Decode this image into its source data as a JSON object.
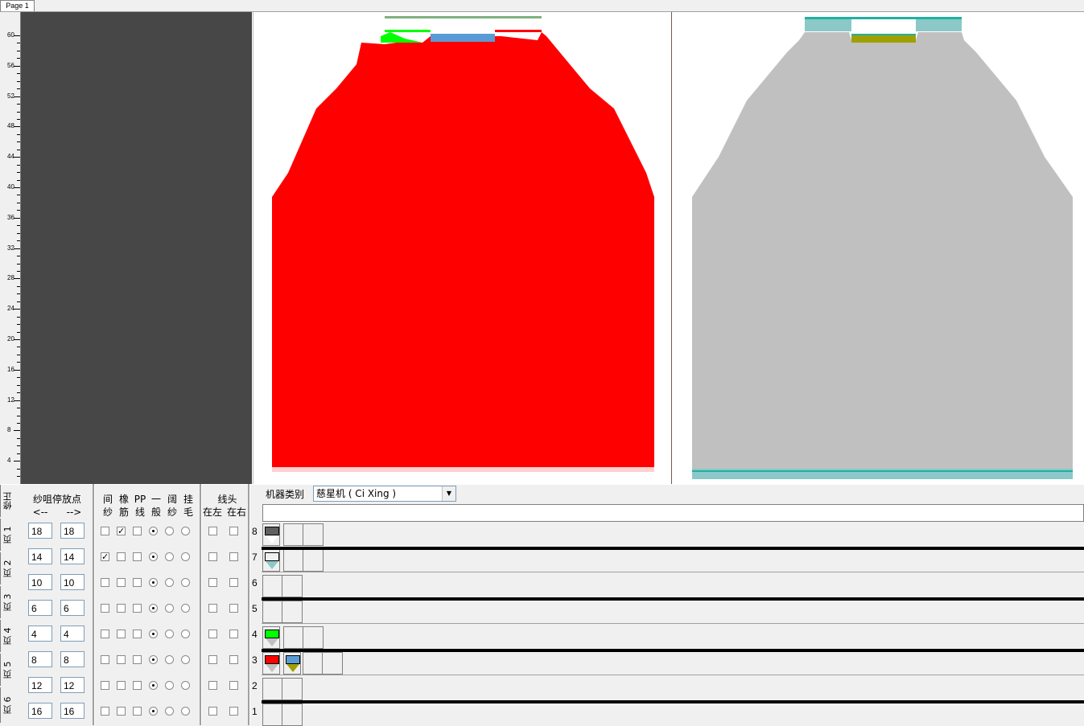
{
  "tabs": [
    {
      "label": "Page  1"
    }
  ],
  "ruler": {
    "labels": [
      "60",
      "56",
      "52",
      "48",
      "44",
      "40",
      "36",
      "32",
      "28",
      "24",
      "20",
      "16",
      "12",
      "8",
      "4"
    ]
  },
  "colors": {
    "red": "#ff0000",
    "green": "#00ff00",
    "blue": "#5b9bd5",
    "gray": "#c0c0c0",
    "teal": "#8cc8c8",
    "dark_teal": "#20b0a0",
    "olive": "#a0a000",
    "dark": "#474747"
  },
  "panel": {
    "side_tab": "修正",
    "page_tabs": [
      "页 1",
      "页 2",
      "页 3",
      "页 4",
      "页 5",
      "页 6"
    ],
    "yarn_header": "纱咀停放点",
    "dir_left": "<--",
    "dir_right": "-->",
    "flag_headers": [
      [
        "间",
        "纱"
      ],
      [
        "橡",
        "筋"
      ],
      [
        "PP",
        "线"
      ],
      [
        "一",
        "般"
      ],
      [
        "阔",
        "纱"
      ],
      [
        "挂",
        "毛"
      ]
    ],
    "thread_header": "线头",
    "thread_sub": [
      "在左",
      "在右"
    ],
    "machine_label": "机器类别",
    "machine_value": "慈星机 ( Ci Xing )",
    "rows": [
      {
        "left": "18",
        "right": "18",
        "jian": false,
        "xiang": true,
        "pp": false,
        "sel": 0
      },
      {
        "left": "14",
        "right": "14",
        "jian": true,
        "xiang": false,
        "pp": false,
        "sel": 0
      },
      {
        "left": "10",
        "right": "10",
        "jian": false,
        "xiang": false,
        "pp": false,
        "sel": 0
      },
      {
        "left": "6",
        "right": "6",
        "jian": false,
        "xiang": false,
        "pp": false,
        "sel": 0
      },
      {
        "left": "4",
        "right": "4",
        "jian": false,
        "xiang": false,
        "pp": false,
        "sel": 0
      },
      {
        "left": "8",
        "right": "8",
        "jian": false,
        "xiang": false,
        "pp": false,
        "sel": 0
      },
      {
        "left": "12",
        "right": "12",
        "jian": false,
        "xiang": false,
        "pp": false,
        "sel": 0
      },
      {
        "left": "16",
        "right": "16",
        "jian": false,
        "xiang": false,
        "pp": false,
        "sel": 0
      }
    ],
    "feeder_rows": [
      "8",
      "7",
      "6",
      "5",
      "4",
      "3",
      "2",
      "1"
    ]
  }
}
